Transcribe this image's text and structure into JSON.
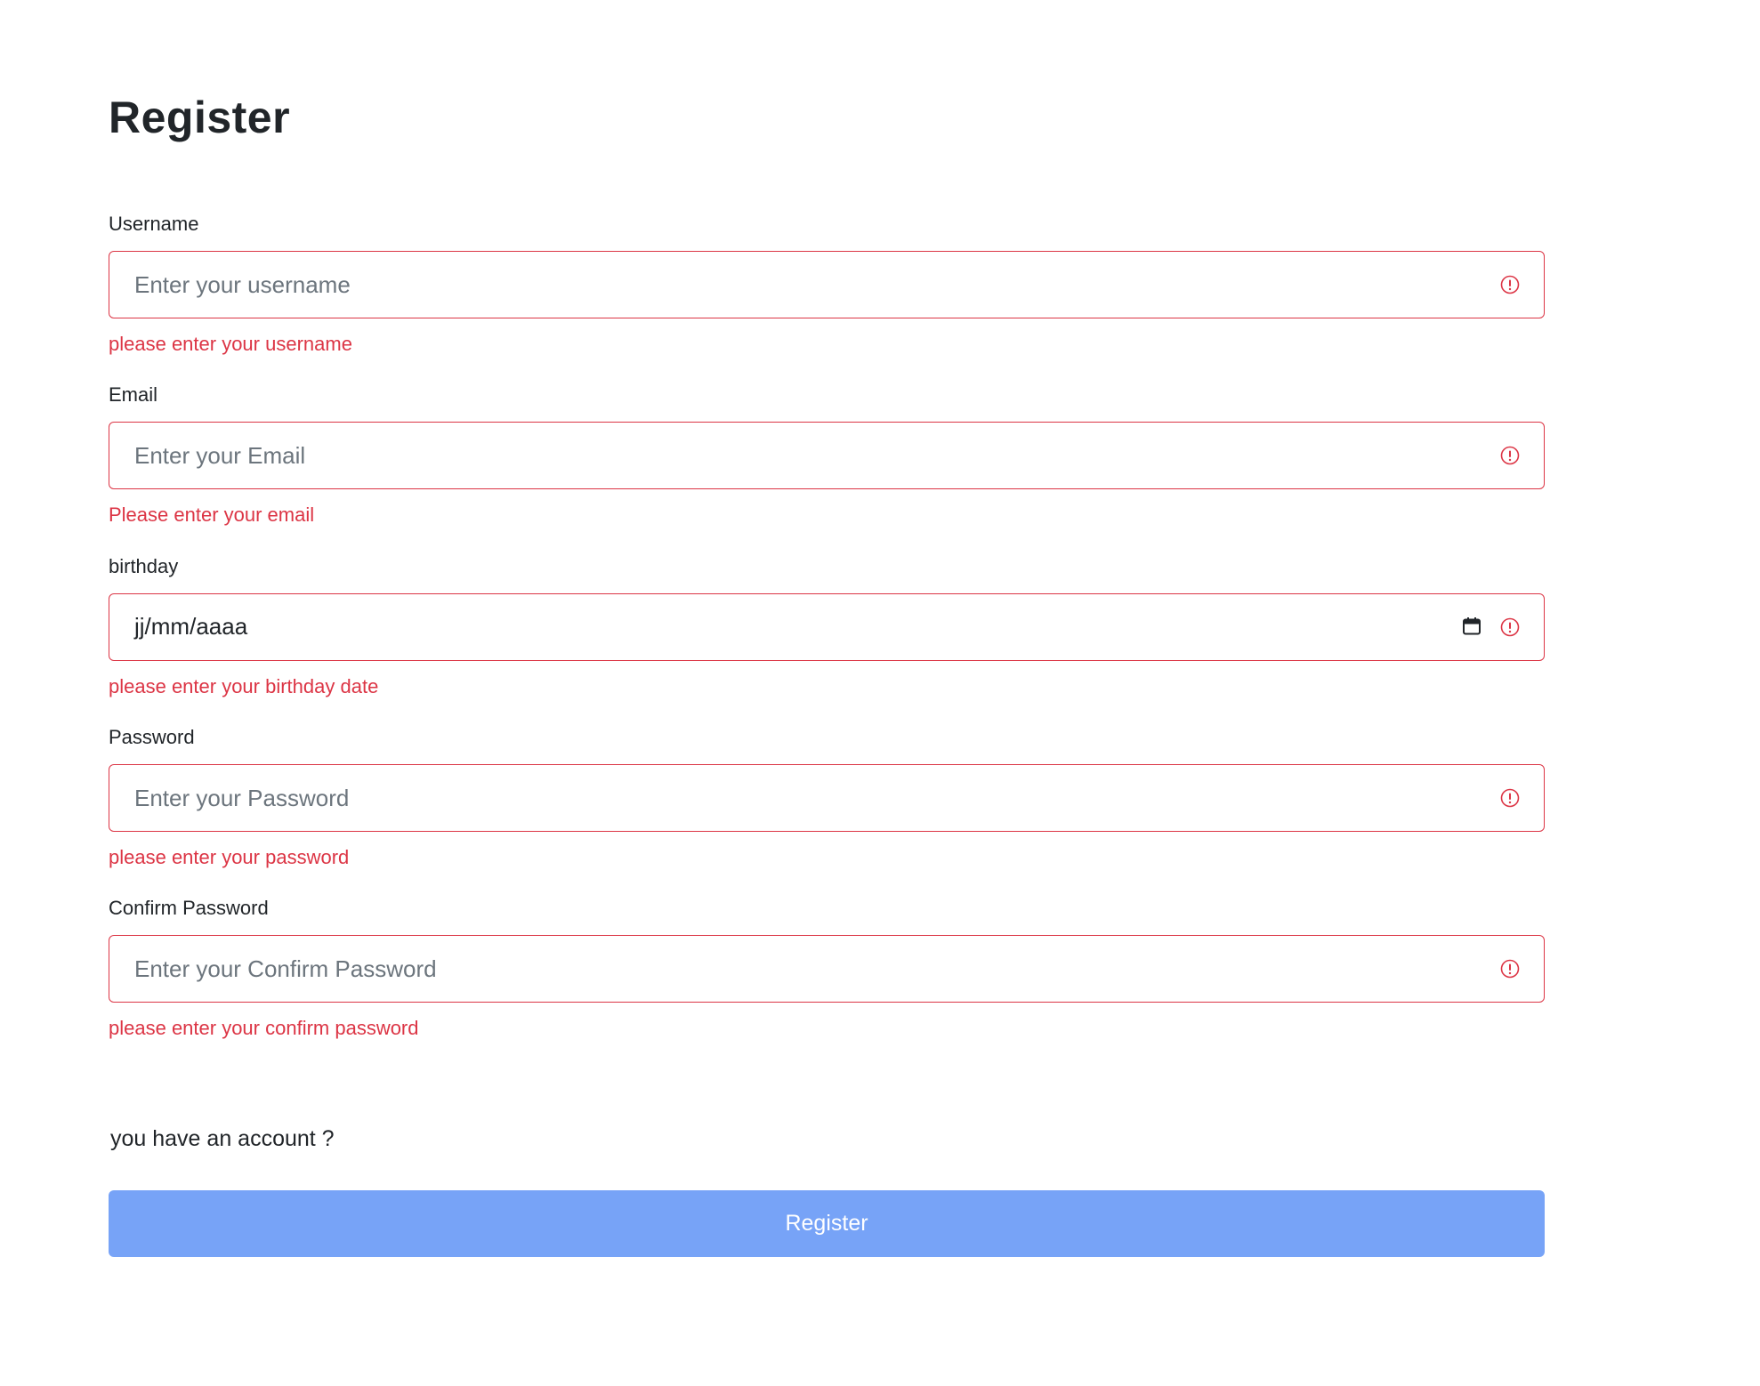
{
  "title": "Register",
  "fields": {
    "username": {
      "label": "Username",
      "placeholder": "Enter your username",
      "error": "please enter your username"
    },
    "email": {
      "label": "Email",
      "placeholder": "Enter your Email",
      "error": "Please enter your email"
    },
    "birthday": {
      "label": "birthday",
      "value": "jj/mm/aaaa",
      "error": "please enter your birthday date"
    },
    "password": {
      "label": "Password",
      "placeholder": "Enter your Password",
      "error": "please enter your password"
    },
    "confirm_password": {
      "label": "Confirm Password",
      "placeholder": "Enter your Confirm Password",
      "error": "please enter your confirm password"
    }
  },
  "account_text": "you have an account ?",
  "register_button": "Register",
  "colors": {
    "error": "#dc3545",
    "button": "#77a3f7",
    "text": "#212529",
    "placeholder": "#6c757d"
  },
  "icons": {
    "invalid": "alert-circle-icon",
    "date": "calendar-icon"
  }
}
